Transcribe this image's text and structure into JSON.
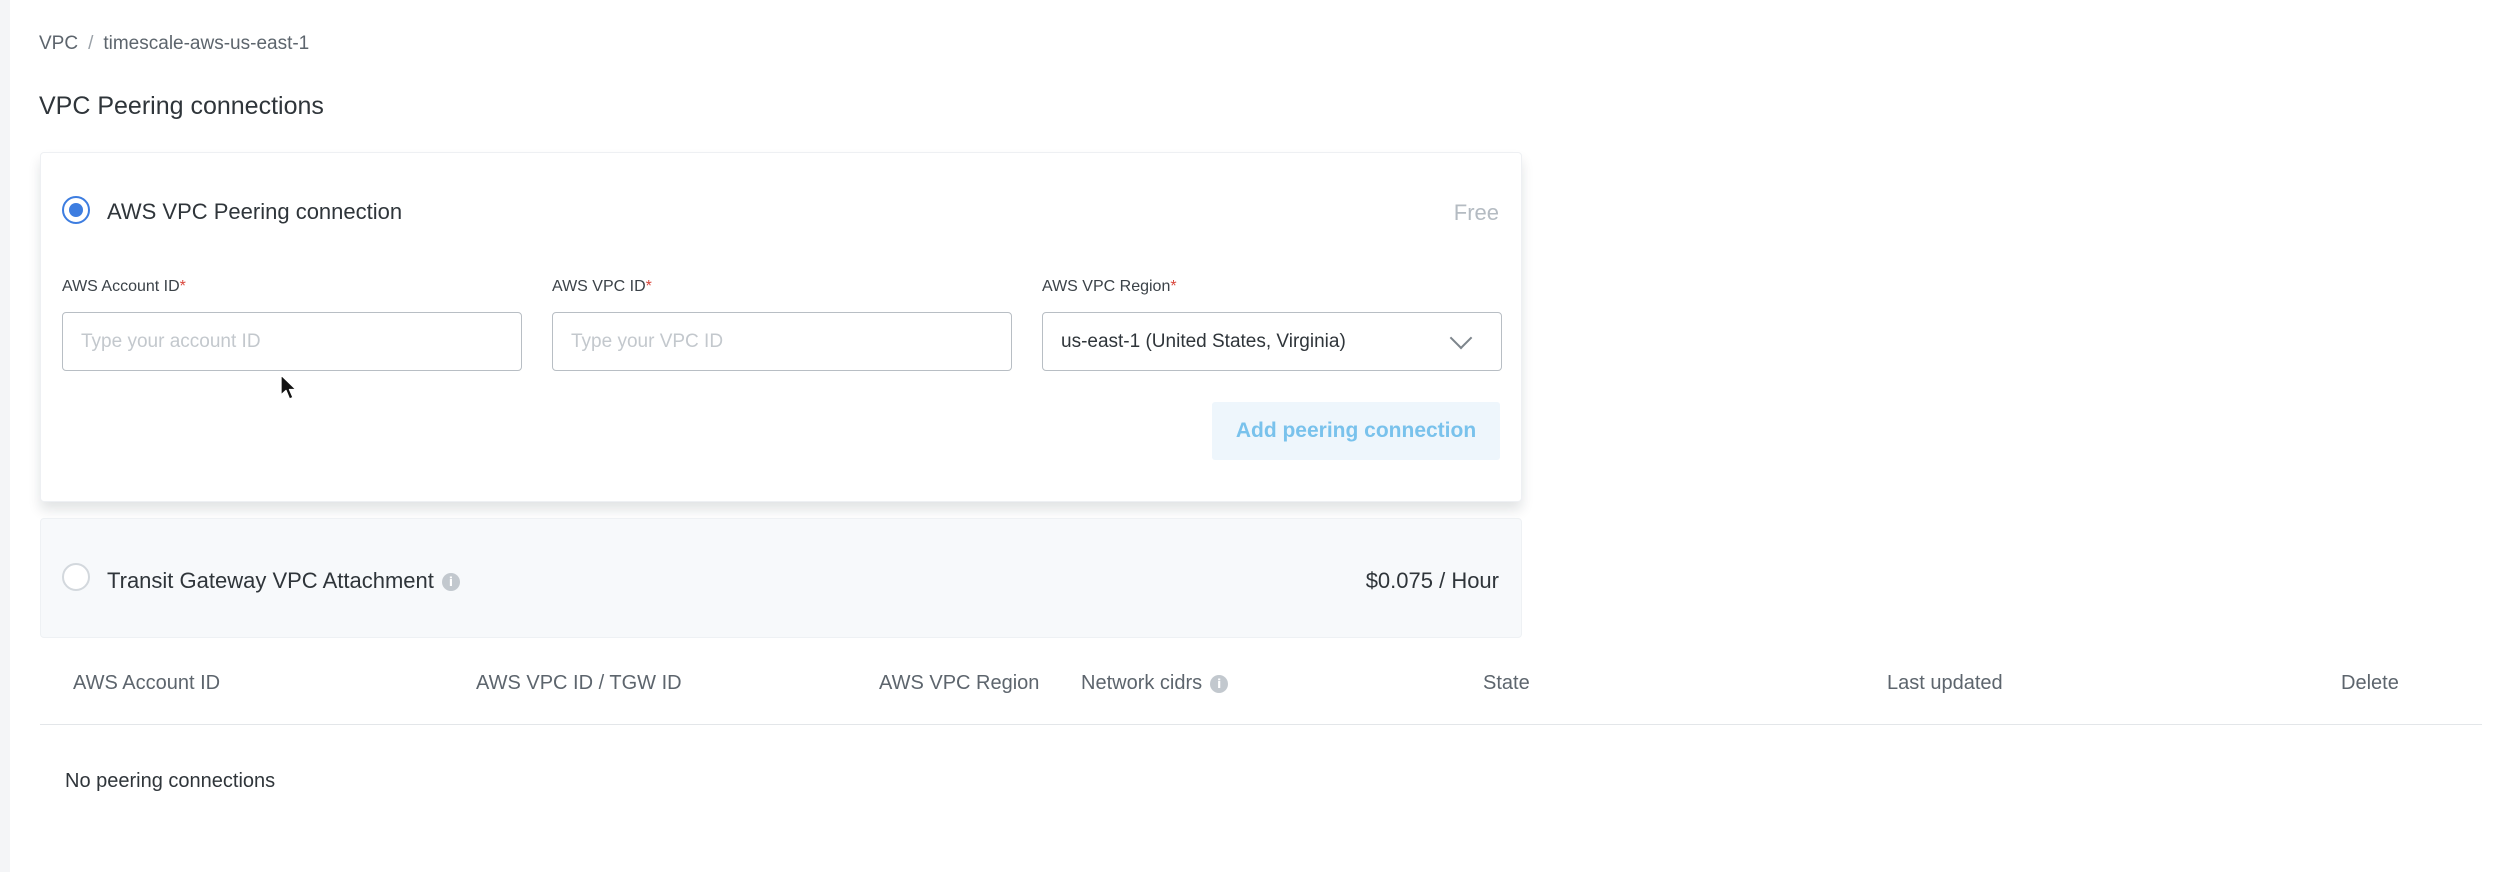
{
  "breadcrumb": {
    "root": "VPC",
    "separator": "/",
    "current": "timescale-aws-us-east-1"
  },
  "page_title": "VPC Peering connections",
  "peering_option": {
    "label": "AWS VPC Peering connection",
    "price": "Free",
    "selected": true,
    "fields": {
      "account_id": {
        "label": "AWS Account ID",
        "required_mark": "*",
        "placeholder": "Type your account ID",
        "value": ""
      },
      "vpc_id": {
        "label": "AWS VPC ID",
        "required_mark": "*",
        "placeholder": "Type your VPC ID",
        "value": ""
      },
      "region": {
        "label": "AWS VPC Region",
        "required_mark": "*",
        "value": "us-east-1 (United States, Virginia)"
      }
    },
    "submit_label": "Add peering connection"
  },
  "transit_option": {
    "label": "Transit Gateway VPC Attachment",
    "price": "$0.075 / Hour",
    "selected": false,
    "info_glyph": "i"
  },
  "table": {
    "columns": [
      "AWS Account ID",
      "AWS VPC ID / TGW ID",
      "AWS VPC Region",
      "Network cidrs",
      "State",
      "Last updated",
      "Delete"
    ],
    "info_glyph": "i",
    "rows": [],
    "empty_message": "No peering connections"
  },
  "colors": {
    "accent": "#3d7de0",
    "required": "#d9473c",
    "button_text": "#79c2ec",
    "button_bg": "#eef6fc"
  }
}
